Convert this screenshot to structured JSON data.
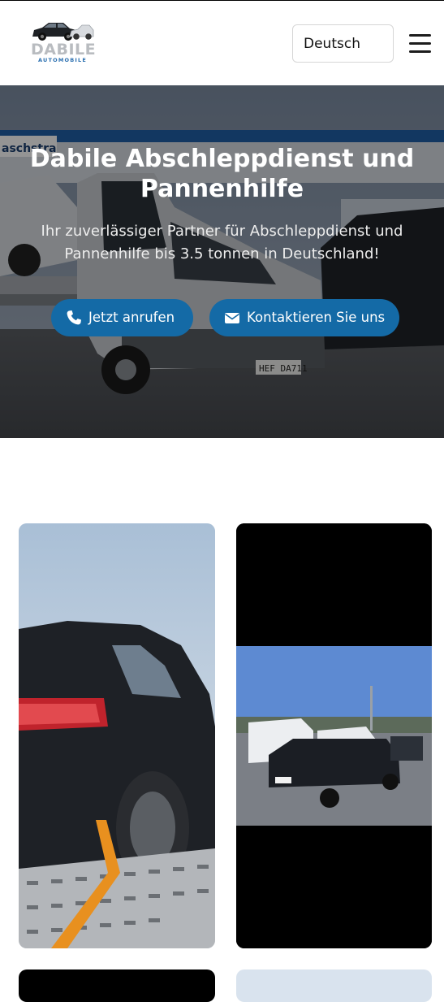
{
  "header": {
    "logo": {
      "name": "DABILE",
      "tagline": "AUTOMOBILE"
    },
    "language_selected": "Deutsch",
    "menu_icon": "hamburger-menu-icon"
  },
  "hero": {
    "title": "Dabile Abschleppdienst und Pannenhilfe",
    "subtitle": "Ihr zuverlässiger Partner für Abschleppdienst und Pannenhilfe bis 3.5 tonnen in Deutschland!",
    "buttons": {
      "call": {
        "label": "Jetzt anrufen",
        "icon": "phone-icon"
      },
      "contact": {
        "label": "Kontaktieren Sie uns",
        "icon": "envelope-icon"
      }
    },
    "background_scene": {
      "sign_text": "aschstra",
      "license_plate": "HEF DA711"
    }
  },
  "colors": {
    "accent": "#146aa6",
    "logo_gray": "#b9bcc0",
    "logo_blue": "#2a6fb0"
  }
}
